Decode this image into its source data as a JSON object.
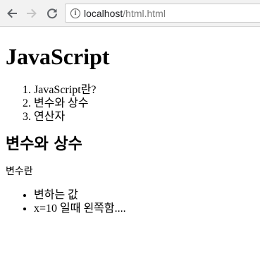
{
  "browser": {
    "url_host": "localhost",
    "url_path": "/html.html"
  },
  "page": {
    "title": "JavaScript",
    "toc": [
      "JavaScript란?",
      "변수와 상수",
      "연산자"
    ],
    "section_heading": "변수와 상수",
    "section_intro": "변수란",
    "section_points": [
      "변하는 값",
      "x=10 일때 왼쪽함...."
    ]
  }
}
